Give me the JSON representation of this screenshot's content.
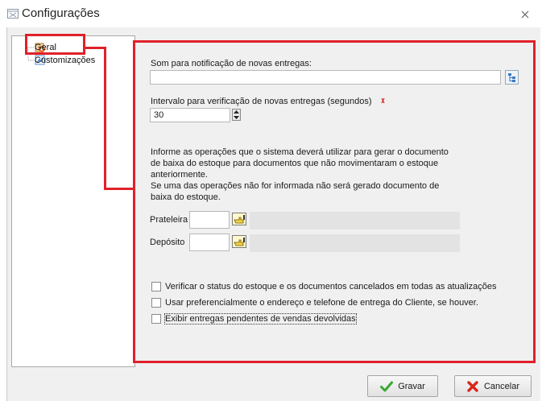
{
  "window": {
    "title": "Configurações"
  },
  "tree": {
    "items": [
      {
        "label": "Geral"
      },
      {
        "label": "Customizações"
      }
    ]
  },
  "form": {
    "notification_label": "Som para notificação de novas entregas:",
    "notification_value": "",
    "interval_label": "Intervalo para verificação de novas entregas (segundos)",
    "interval_value": "30",
    "info_lines": [
      "Informe as operações que o sistema deverá utilizar para gerar o documento",
      "de baixa do estoque para documentos que não movimentaram o estoque",
      "anteriormente.",
      "Se uma das operações não for informada não será gerado documento de",
      "baixa do estoque."
    ],
    "prateleira_label": "Prateleira",
    "prateleira_value": "",
    "deposito_label": "Depósito",
    "deposito_value": "",
    "checkboxes": [
      {
        "label": "Verificar o status do estoque e os documentos cancelados em todas as atualizações",
        "checked": false
      },
      {
        "label": "Usar preferencialmente o endereço e telefone de entrega do Cliente, se houver.",
        "checked": false
      },
      {
        "label": "Exibir entregas pendentes de vendas devolvidas",
        "checked": false
      }
    ]
  },
  "buttons": {
    "save_label": "Gravar",
    "cancel_label": "Cancelar"
  },
  "colors": {
    "highlight_red": "#e0212b",
    "save_check_green": "#3aa832",
    "cancel_x_red": "#d9261c"
  }
}
